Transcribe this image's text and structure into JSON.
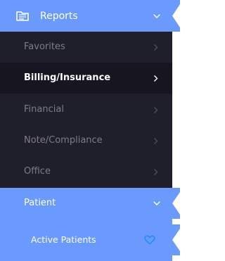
{
  "menu": {
    "header": {
      "label": "Reports",
      "icon": "reports-folder-icon",
      "chevron": "chevron-down-icon"
    },
    "items": [
      {
        "label": "Favorites",
        "active": false
      },
      {
        "label": "Billing/Insurance",
        "active": true
      },
      {
        "label": "Financial",
        "active": false
      },
      {
        "label": "Note/Compliance",
        "active": false
      },
      {
        "label": "Office",
        "active": false
      }
    ],
    "patient": {
      "label": "Patient",
      "chevron": "chevron-down-icon"
    },
    "active_patients": {
      "label": "Active Patients",
      "icon": "heart-outline-icon"
    }
  },
  "colors": {
    "accent": "#6b9aff",
    "menu_bg": "#1f1e2b",
    "menu_active_bg": "#171620",
    "muted_text": "#7d7c86",
    "heart_color": "#1890ff"
  }
}
